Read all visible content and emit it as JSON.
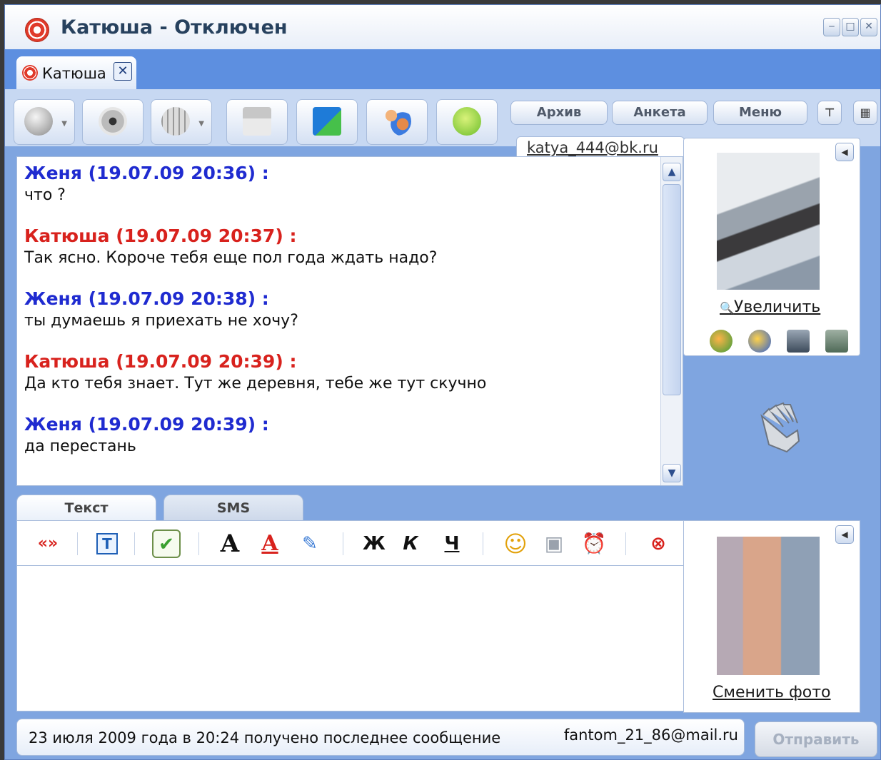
{
  "window": {
    "title": "Катюша - Отключен",
    "controls": [
      "minimize",
      "maximize",
      "close"
    ]
  },
  "tab": {
    "label": "Катюша",
    "close_symbol": "✕"
  },
  "toolbar": {
    "tool_icons": [
      "phone-icon",
      "webcam-icon",
      "globe-icon",
      "save-icon",
      "file-transfer-icon",
      "contacts-group-icon",
      "chat-bubble-icon"
    ],
    "archive_label": "Архив",
    "profile_label": "Анкета",
    "menu_label": "Меню"
  },
  "contact_email": "katya_444@bk.ru",
  "messages": [
    {
      "sender": "Женя",
      "time": "(19.07.09 20:36) :",
      "text": "что ?",
      "color": "blue"
    },
    {
      "sender": "Катюша",
      "time": "(19.07.09 20:37) :",
      "text": "Так ясно. Короче тебя еще пол года ждать надо?",
      "color": "red"
    },
    {
      "sender": "Женя",
      "time": "(19.07.09 20:38) :",
      "text": "ты думаешь я приехать не хочу?",
      "color": "blue"
    },
    {
      "sender": "Катюша",
      "time": "(19.07.09 20:39) :",
      "text": "Да кто тебя знает. Тут же деревня, тебе же тут скучно",
      "color": "red"
    },
    {
      "sender": "Женя",
      "time": "(19.07.09 20:39) :",
      "text": "да перестань",
      "color": "blue"
    }
  ],
  "contact_panel": {
    "enlarge_label": "Увеличить"
  },
  "input_tabs": {
    "text_tab": "Текст",
    "sms_tab": "SMS"
  },
  "format_bar": {
    "quote": "«»",
    "bold": "Ж",
    "italic": "К",
    "underline": "Ч"
  },
  "own_panel": {
    "change_photo_label": "Сменить фото"
  },
  "status": {
    "last_message": "23 июля 2009 года в 20:24 получено последнее сообщение",
    "own_email": "fantom_21_86@mail.ru"
  },
  "send_label": "Отправить",
  "colors": {
    "blue_sender": "#1f2bd0",
    "red_sender": "#d8221d",
    "frame": "#7fa5e0"
  }
}
